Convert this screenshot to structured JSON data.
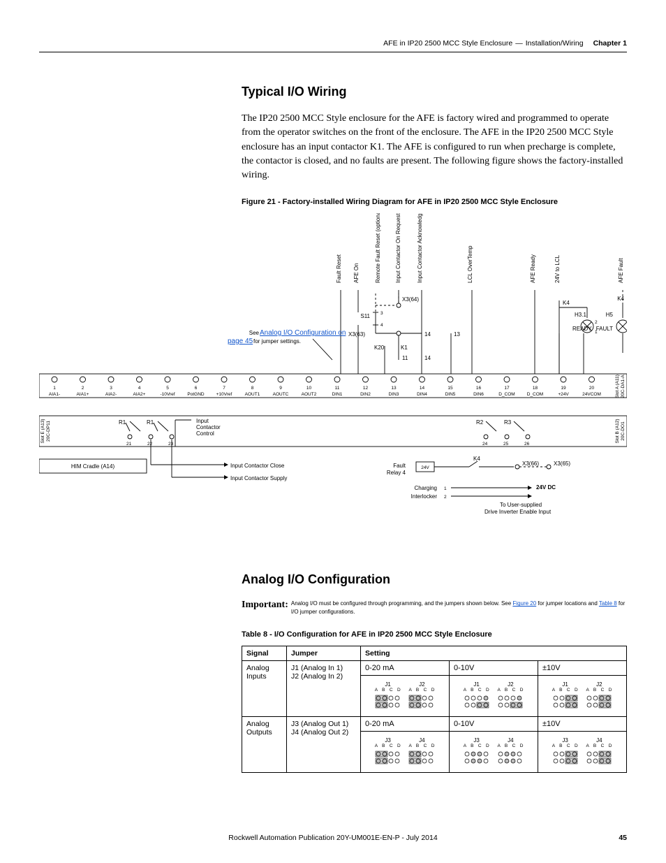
{
  "header": {
    "breadcrumb_left": "AFE in IP20 2500 MCC Style Enclosure",
    "breadcrumb_right": "Installation/Wiring",
    "chapter": "Chapter 1"
  },
  "section1": {
    "title": "Typical I/O Wiring",
    "body": "The IP20 2500 MCC Style enclosure for the AFE is factory wired and programmed to operate from the operator switches on the front of the enclosure. The AFE in the IP20 2500 MCC Style enclosure has an input contactor K1. The AFE is configured to run when precharge is complete, the contactor is closed, and no faults are present. The following figure shows the factory-installed wiring.",
    "figure_caption": "Figure 21 - Factory-installed Wiring Diagram for AFE in IP20 2500 MCC Style Enclosure",
    "jumper_note_prefix": "See ",
    "jumper_note_link": "Analog I/O Configuration on page 45",
    "jumper_note_suffix": " for jumper settings."
  },
  "diagram": {
    "top_labels": [
      "Fault Reset",
      "AFE On",
      "Remote Fault Reset (optional)",
      "Input Contactor On Request",
      "Input Contactor Acknowledge",
      "LCL OverTemp",
      "AFE Ready",
      "24V to LCL",
      "AFE Fault"
    ],
    "s11": "S11",
    "x364": "X3(64)",
    "x363": "X3(63)",
    "x366": "X3(66)",
    "x365": "X3(65)",
    "k20": "K20",
    "k1": "K1",
    "k4": "K4",
    "h31": "H3.1",
    "ready": "READY",
    "h5": "H5",
    "fault": "FAULT",
    "terminals": [
      {
        "n": "1",
        "t": "AIA1-"
      },
      {
        "n": "2",
        "t": "AIA1+"
      },
      {
        "n": "3",
        "t": "AIA2-"
      },
      {
        "n": "4",
        "t": "AIA2+"
      },
      {
        "n": "5",
        "t": "-10Vref"
      },
      {
        "n": "6",
        "t": "PotGND"
      },
      {
        "n": "7",
        "t": "+10Vref"
      },
      {
        "n": "8",
        "t": "AOUT1"
      },
      {
        "n": "9",
        "t": "AOUTC"
      },
      {
        "n": "10",
        "t": "AOUT2"
      },
      {
        "n": "11",
        "t": "DIN1"
      },
      {
        "n": "12",
        "t": "DIN2"
      },
      {
        "n": "13",
        "t": "DIN3"
      },
      {
        "n": "14",
        "t": "DIN4"
      },
      {
        "n": "15",
        "t": "DIN5"
      },
      {
        "n": "16",
        "t": "DIN6"
      },
      {
        "n": "17",
        "t": "D_COM"
      },
      {
        "n": "18",
        "t": "D_COM"
      },
      {
        "n": "19",
        "t": "+24V"
      },
      {
        "n": "20",
        "t": "24VCOM"
      }
    ],
    "lower_terms": [
      "21",
      "22",
      "23",
      "24",
      "25",
      "26"
    ],
    "r1": "R1",
    "r2": "R2",
    "r3": "R3",
    "slot_a11": "20C-DA1-A\nSlot A (A11)",
    "slot_a12": "20C-DO1\nSlot B (A12)",
    "slot_a13": "20C-DP11\nSlot E (A13)",
    "him": "HIM Cradle (A14)",
    "icc": "Input\nContactor\nControl",
    "icc_close": "Input Contactor Close",
    "icc_supply": "Input Contactor Supply",
    "fault_relay": "Fault\nRelay 4",
    "charging": "Charging",
    "interlock": "Interlocker",
    "v24": "24V",
    "v24dc": "24V DC",
    "to_user": "To User-supplied\nDrive Inverter Enable Input"
  },
  "section2": {
    "title": "Analog I/O Configuration",
    "important_label": "Important:",
    "important_body_pre": "Analog I/O must be configured through programming, and the jumpers shown below. See ",
    "important_link1": "Figure 20",
    "important_body_mid": " for jumper locations and ",
    "important_link2": "Table 8",
    "important_body_post": " for I/O jumper configurations.",
    "table_caption": "Table 8 - I/O Configuration for AFE in IP20 2500 MCC Style Enclosure"
  },
  "table": {
    "headers": [
      "Signal",
      "Jumper",
      "Setting"
    ],
    "modes": [
      "0-20 mA",
      "0-10V",
      "±10V"
    ],
    "row1": {
      "signal": "Analog Inputs",
      "jumper1": "J1 (Analog In 1)",
      "jumper2": "J2 (Analog In 2)",
      "blocks1": [
        "J1",
        "J2"
      ],
      "blocks2": [
        "J1",
        "J2"
      ],
      "blocks3": [
        "J1",
        "J2"
      ]
    },
    "row2": {
      "signal": "Analog Outputs",
      "jumper1": "J3 (Analog Out 1)",
      "jumper2": "J4 (Analog Out 2)",
      "blocks1": [
        "J3",
        "J4"
      ],
      "blocks2": [
        "J3",
        "J4"
      ],
      "blocks3": [
        "J3",
        "J4"
      ]
    },
    "letters": "A B C D"
  },
  "footer": {
    "text": "Rockwell Automation Publication 20Y-UM001E-EN-P - July 2014",
    "page": "45"
  }
}
